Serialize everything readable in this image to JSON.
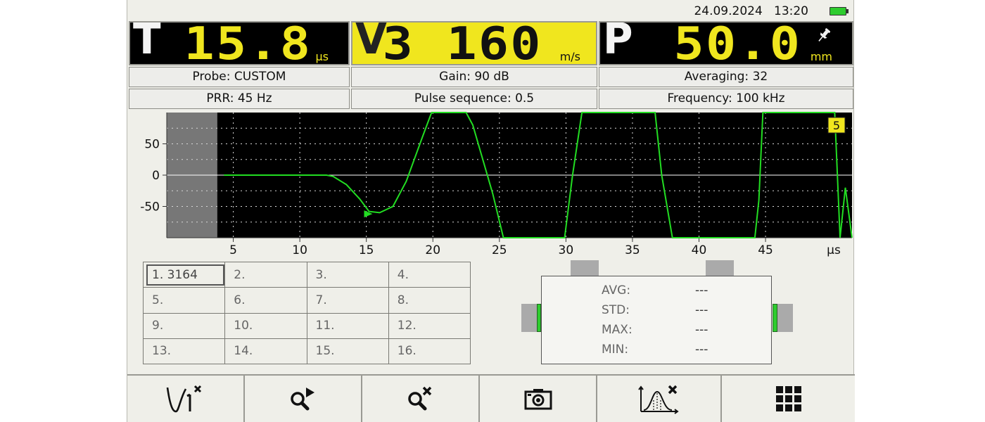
{
  "status": {
    "date": "24.09.2024",
    "time": "13:20",
    "battery_icon": "battery-full-icon"
  },
  "metrics": {
    "T": {
      "letter": "T",
      "value": "15.8",
      "unit": "µs"
    },
    "V": {
      "letter": "V",
      "value": "3 160",
      "unit": "m/s"
    },
    "P": {
      "letter": "P",
      "value": "50.0",
      "unit": "mm"
    }
  },
  "info": {
    "probe": "Probe: CUSTOM",
    "gain": "Gain: 90 dB",
    "averaging": "Averaging: 32",
    "prr": "PRR: 45 Hz",
    "pulse_sequence": "Pulse sequence: 0.5",
    "frequency": "Frequency: 100 kHz"
  },
  "chart_data": {
    "type": "line",
    "x_unit": "µs",
    "xlim": [
      0,
      51.5
    ],
    "ylim": [
      -100,
      100
    ],
    "x_ticks": [
      5,
      10,
      15,
      20,
      25,
      30,
      35,
      40,
      45
    ],
    "x_tick_labels": [
      "5",
      "10",
      "15",
      "20",
      "25",
      "30",
      "35",
      "40",
      "45"
    ],
    "y_ticks": [
      50,
      0,
      -50
    ],
    "y_tick_labels": [
      "50",
      "0",
      "-50"
    ],
    "grid": true,
    "dead_zone": [
      0,
      3.8
    ],
    "marker": {
      "x": 15.2,
      "y": -62,
      "label": "5"
    },
    "series": [
      {
        "color": "#22dd22",
        "x": [
          4.3,
          12.0,
          12.5,
          13.5,
          14.5,
          15.2,
          16.0,
          17.0,
          18.0,
          19.2,
          19.9,
          22.5,
          23.0,
          24.5,
          25.3,
          29.5,
          29.9,
          30.5,
          31.2,
          36.7,
          37.2,
          38.0,
          44.2,
          44.5,
          44.8,
          50.2,
          50.4,
          50.6,
          51.0,
          51.5
        ],
        "y": [
          0,
          0,
          -2,
          -15,
          -38,
          -58,
          -60,
          -50,
          -10,
          60,
          100,
          100,
          80,
          -30,
          -100,
          -100,
          -100,
          0,
          100,
          100,
          0,
          -100,
          -100,
          -40,
          100,
          100,
          0,
          -100,
          -20,
          -100
        ]
      }
    ]
  },
  "readings": {
    "cells": [
      "1.  3164",
      "2.",
      "3.",
      "4.",
      "5.",
      "6.",
      "7.",
      "8.",
      "9.",
      "10.",
      "11.",
      "12.",
      "13.",
      "14.",
      "15.",
      "16."
    ]
  },
  "stats": {
    "avg_label": "AVG:",
    "avg_value": "---",
    "std_label": "STD:",
    "std_value": "---",
    "max_label": "MAX:",
    "max_value": "---",
    "min_label": "MIN:",
    "min_value": "---"
  },
  "toolbar": {
    "icons": [
      "curve-select-icon",
      "zoom-play-icon",
      "zoom-reset-icon",
      "camera-icon",
      "distribution-icon",
      "grid-menu-icon"
    ]
  },
  "colors": {
    "accent_yellow": "#f0e61e",
    "signal_green": "#22dd22",
    "panel_black": "#000000"
  }
}
